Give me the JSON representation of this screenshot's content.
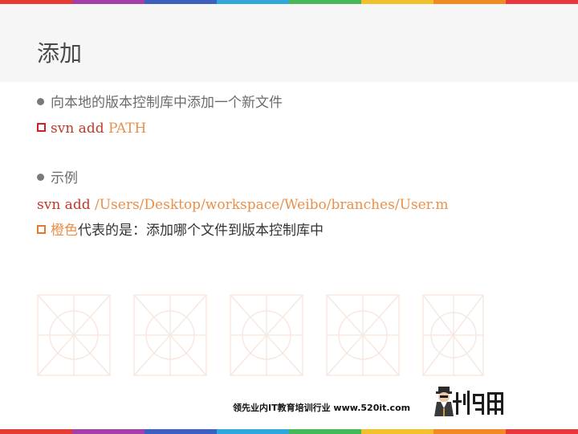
{
  "slide": {
    "title": "添加",
    "stripe_colors": [
      "#e63a35",
      "#a33fa8",
      "#3d5fbd",
      "#2ea8d8",
      "#46b85a",
      "#f1c12b",
      "#f28a23",
      "#e8383d"
    ],
    "lines": [
      {
        "prefix": "向本地的版本控制库中添加一个新文件"
      },
      {
        "part1": "svn add ",
        "part2": "PATH"
      },
      {
        "prefix": "示例"
      },
      {
        "part1": "svn add ",
        "part2": "/Users/Desktop/workspace/Weibo/branches/User.m"
      },
      {
        "part1": "橙色",
        "part2": "代表的是：添加哪个文件到版本控制库中"
      }
    ],
    "footer": "领先业内IT教育培训行业 www.520it.com"
  }
}
